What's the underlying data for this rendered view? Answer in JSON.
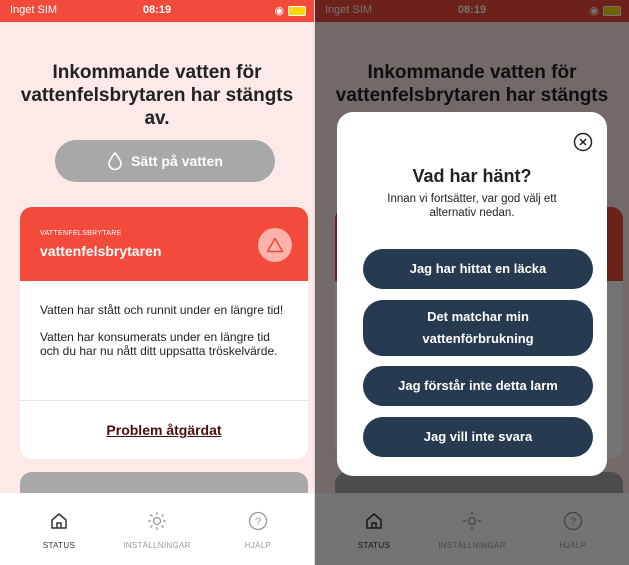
{
  "status_bar": {
    "carrier": "Inget SIM",
    "time": "08:19"
  },
  "main": {
    "headline": "Inkommande vatten för vattenfelsbrytaren har stängts av.",
    "water_button_label": "Sätt på vatten",
    "alert_card": {
      "type_label": "VATTENFELSBRYTARE",
      "title": "vattenfelsbrytaren",
      "message_1": "Vatten har stått och runnit under en längre tid!",
      "message_2": "Vatten har konsumerats under en längre tid och du har nu nått ditt uppsatta tröskelvärde.",
      "action_label": "Problem åtgärdat"
    }
  },
  "tabbar": {
    "tabs": [
      {
        "label": "STATUS",
        "icon": "home-icon",
        "active": true
      },
      {
        "label": "INSTÄLLNINGAR",
        "icon": "sun-settings-icon",
        "active": false
      },
      {
        "label": "HJÄLP",
        "icon": "help-icon",
        "active": false
      }
    ]
  },
  "modal": {
    "title": "Vad har hänt?",
    "subtitle": "Innan vi fortsätter, var god välj ett alternativ nedan.",
    "options": [
      "Jag har hittat en läcka",
      "Det matchar min vattenförbrukning",
      "Jag förstår inte detta larm",
      "Jag vill inte svara"
    ]
  },
  "colors": {
    "accent": "#f24b3c",
    "background": "#fde9e7",
    "button_dark": "#263a50",
    "button_disabled": "#a8a8a8"
  }
}
